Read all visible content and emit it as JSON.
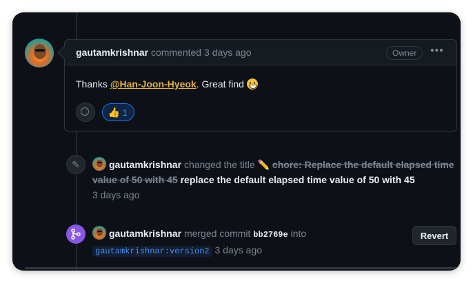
{
  "comment": {
    "author": "gautamkrishnar",
    "action": "commented",
    "time": "3 days ago",
    "badge": "Owner",
    "more_label": "•••",
    "body_prefix": "Thanks ",
    "mention": "@Han-Joon-Hyeok",
    "body_suffix": ". Great find ",
    "reactions": [
      {
        "emoji": "👍",
        "count": "1"
      }
    ]
  },
  "title_event": {
    "author": "gautamkrishnar",
    "action": "changed the title",
    "old_title": "chore: Replace the default elapsed time value of 50 with 45",
    "new_title": "replace the default elapsed time value of 50 with 45",
    "time": "3 days ago"
  },
  "merge_event": {
    "author": "gautamkrishnar",
    "action": "merged commit",
    "sha": "bb2769e",
    "into_label": "into",
    "branch": "gautamkrishnar:version2",
    "time": "3 days ago",
    "revert_label": "Revert"
  },
  "colors": {
    "background": "#0d1117",
    "mention": "#e3b341",
    "link": "#4493f8",
    "merge_purple": "#8957e5"
  }
}
